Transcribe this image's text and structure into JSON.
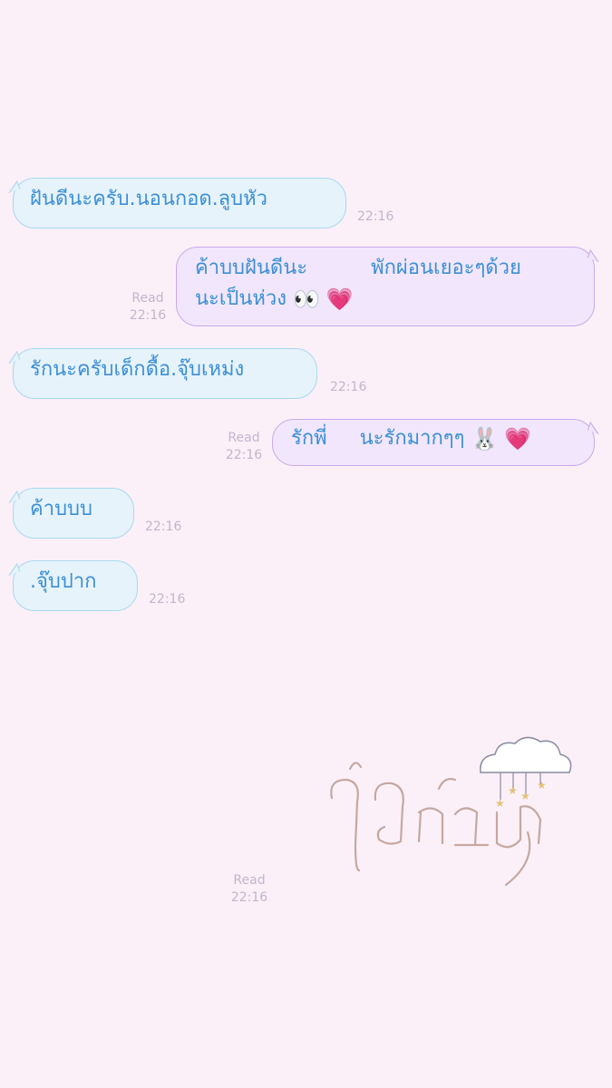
{
  "messages": [
    {
      "text": "ฝันดีนะครับ.นอนกอด.ลูบหัว",
      "time": "22:16"
    },
    {
      "line1_a": "ค้าบบฝันดีนะ",
      "line1_b": "พักผ่อนเยอะๆด้วย",
      "line2": "นะเป็นห่วง",
      "emoji1": "👀",
      "emoji2": "💗",
      "read": "Read",
      "time": "22:16"
    },
    {
      "text": "รักนะครับเด็กดื้อ.จุ๊บเหม่ง",
      "time": "22:16"
    },
    {
      "text_a": "รักพี่",
      "text_b": "นะรักมากๆๆ",
      "emoji1": "🐰",
      "emoji2": "💗",
      "read": "Read",
      "time": "22:16"
    },
    {
      "text": "ค้าบบบ",
      "time": "22:16"
    },
    {
      "text": ".จุ๊บปาก",
      "time": "22:16"
    }
  ],
  "sticker": {
    "read": "Read",
    "time": "22:16",
    "icon": "cloud-icon"
  },
  "colors": {
    "background": "#fcf0f8",
    "incoming_bubble": "#e6f3fb",
    "outgoing_bubble": "#f1e6fb",
    "text": "#3b8fd6"
  }
}
